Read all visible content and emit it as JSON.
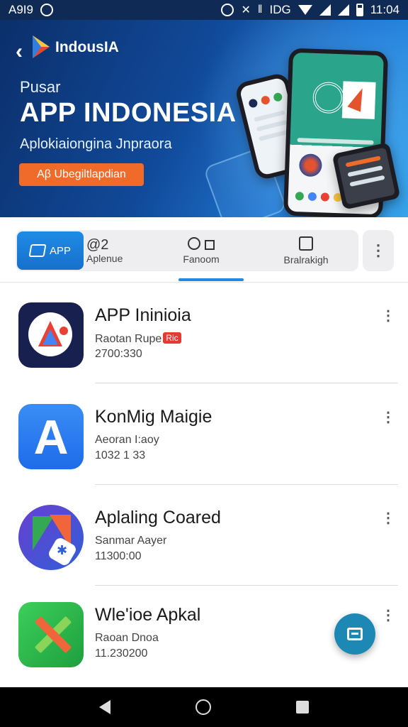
{
  "status_bar": {
    "carrier": "A9I9",
    "time": "11:04",
    "network_label": "IDG"
  },
  "hero": {
    "brand_name": "IndousIA",
    "subtitle": "Pusar",
    "title": "APP INDONESIA",
    "tagline": "Aplokiaiongina Jnpraora",
    "cta_label": "Aβ Ubegiltlapdian"
  },
  "tabs": [
    {
      "label": "APP",
      "icon": "app-icon",
      "selected": false,
      "highlighted": true
    },
    {
      "top": "@2",
      "label": "Aplenue",
      "selected": false
    },
    {
      "label": "Fanoom",
      "icon": "circle-square-icon",
      "selected": true
    },
    {
      "label": "Bralrakigh",
      "icon": "bag-icon",
      "selected": false
    }
  ],
  "apps": [
    {
      "name": "APP Ininioia",
      "publisher": "Raotan Rupe",
      "badge": "Ric",
      "number": "2700:330",
      "icon": "app-logo-triangle-bubble"
    },
    {
      "name": "KonMig Maigie",
      "publisher": "Aeoran I:aoy",
      "number": "1032 1 33",
      "icon": "app-logo-letter-a"
    },
    {
      "name": "Aplaling Coared",
      "publisher": "Sanmar Aayer",
      "number": "11300:00",
      "icon": "app-logo-hex"
    },
    {
      "name": "Wle'ioe Apkal",
      "publisher": "Raoan Dnoa",
      "number": "11.230200",
      "icon": "app-logo-cross"
    }
  ],
  "app_letter": "A",
  "colors": {
    "accent": "#1f8be6",
    "cta": "#f06a2a",
    "fab": "#1e88b4"
  }
}
